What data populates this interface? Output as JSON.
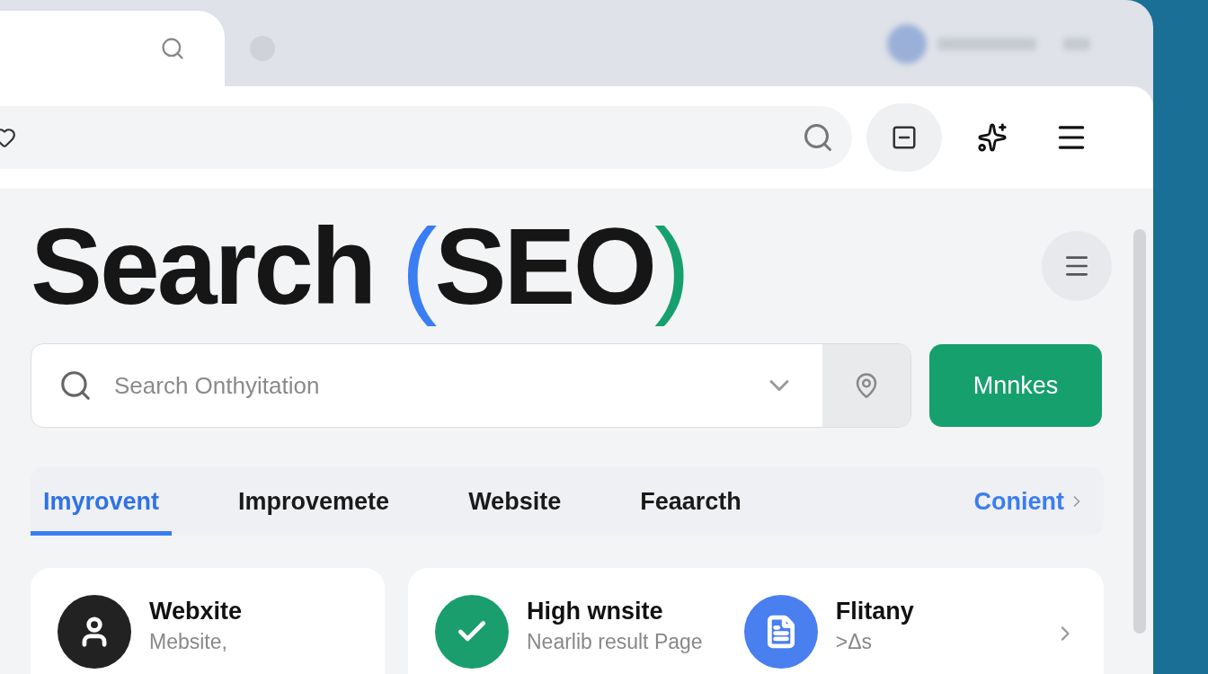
{
  "title": {
    "word": "Search",
    "open": "(",
    "inner": "SEO",
    "close": ")"
  },
  "search": {
    "placeholder": "Search Onthyitation"
  },
  "action_button": "Mnnkes",
  "tabs": [
    {
      "label": "Imyrovent",
      "kind": "tab",
      "selected": true
    },
    {
      "label": "Improvemete",
      "kind": "tab",
      "selected": false
    },
    {
      "label": "Website",
      "kind": "tab",
      "selected": false
    },
    {
      "label": "Feaarcth",
      "kind": "tab",
      "selected": false
    },
    {
      "label": "Conient",
      "kind": "link",
      "selected": false
    }
  ],
  "cards": [
    {
      "items": [
        {
          "kind": "user",
          "color": "#222222",
          "title": "Webxite",
          "subtitle": "Mebsite,"
        }
      ],
      "chevron": false
    },
    {
      "items": [
        {
          "kind": "check",
          "color": "#1a9e6e",
          "title": "High wnsite",
          "subtitle": "Nearlib result Page"
        },
        {
          "kind": "doc",
          "color": "#4a7ff0",
          "title": "Flitany",
          "subtitle": ">Δs"
        }
      ],
      "chevron": true
    }
  ]
}
